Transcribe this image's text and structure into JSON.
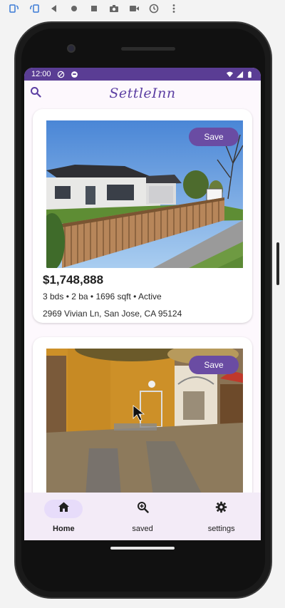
{
  "emulator_toolbar": {
    "icons": [
      "rotate-left-icon",
      "rotate-right-icon",
      "back-icon",
      "home-icon",
      "overview-icon",
      "camera-icon",
      "video-icon",
      "snapshot-icon",
      "more-icon"
    ]
  },
  "status_bar": {
    "time": "12:00"
  },
  "header": {
    "logo": "SettleInn"
  },
  "listings": [
    {
      "save_label": "Save",
      "price": "$1,748,888",
      "details": "3 bds • 2 ba • 1696 sqft • Active",
      "address": "2969 Vivian Ln, San Jose, CA 95124"
    },
    {
      "save_label": "Save",
      "price": "",
      "details": "",
      "address": ""
    }
  ],
  "bottom_nav": {
    "items": [
      {
        "label": "Home",
        "icon": "home-icon",
        "active": true
      },
      {
        "label": "saved",
        "icon": "zoom-in-icon",
        "active": false
      },
      {
        "label": "settings",
        "icon": "gear-icon",
        "active": false
      }
    ]
  },
  "colors": {
    "accent": "#5a3d94",
    "save_button": "#6a4ca3",
    "nav_background": "#f3ebf7",
    "nav_active_pill": "#e7dcfa"
  }
}
